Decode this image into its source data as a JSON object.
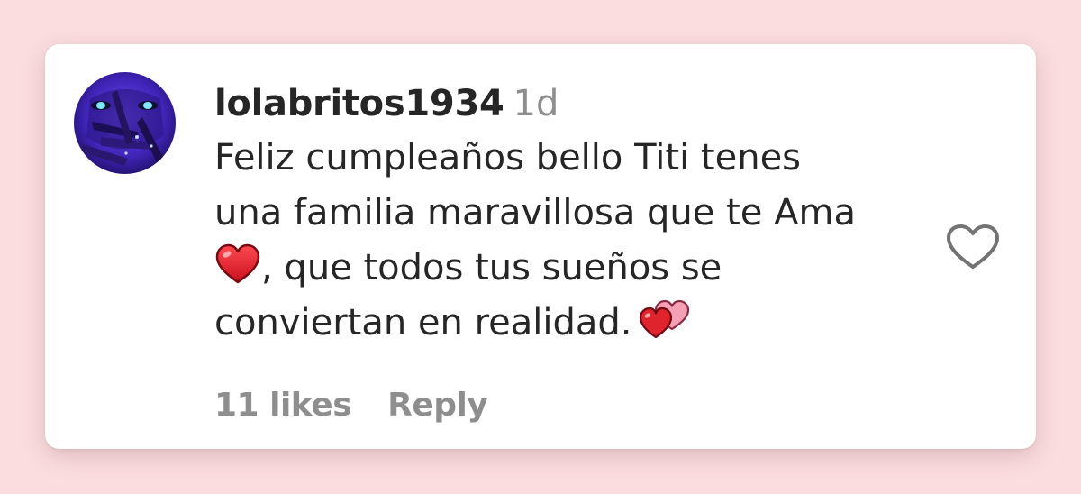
{
  "comment": {
    "username": "lolabritos1934",
    "timestamp": "1d",
    "text_lines": [
      "Feliz cumpleaños bello Titi tenes",
      "una familia maravillosa que te Ama",
      ", que todos tus sueños se",
      "conviertan en realidad."
    ],
    "emojis": {
      "line3_prefix": "red-heart-icon",
      "line4_suffix": "two-hearts-icon"
    },
    "likes_label": "11 likes",
    "reply_label": "Reply",
    "like_icon": "heart-outline-icon"
  },
  "colors": {
    "page_background": "#fbdddf",
    "card_background": "#ffffff",
    "text_primary": "#262626",
    "text_secondary": "#8e8e8e",
    "heart_red": "#e0242e",
    "avatar_purple": "#4a2fd0"
  }
}
